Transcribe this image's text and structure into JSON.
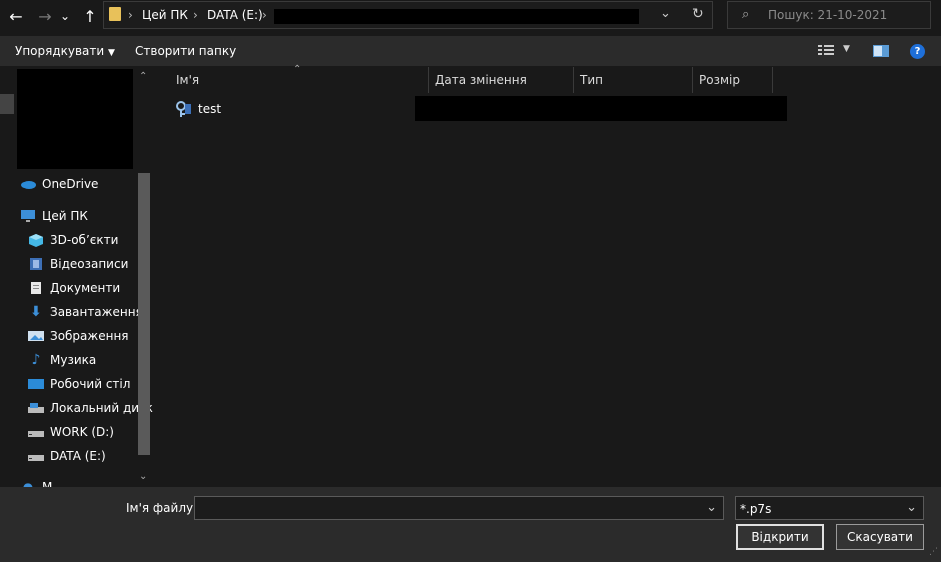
{
  "nav": {
    "back": "←",
    "forward": "→",
    "recent": "⌄",
    "up": "↑"
  },
  "address": {
    "crumbs": [
      "Цей ПК",
      "DATA (E:)"
    ],
    "sep": "›"
  },
  "search": {
    "placeholder": "Пошук: 21-10-2021"
  },
  "toolbar": {
    "organize": "Упорядкувати",
    "new_folder": "Створити папку"
  },
  "sidebar": {
    "onedrive": "OneDrive",
    "this_pc": "Цей ПК",
    "items": [
      {
        "label": "3D-об’єкти",
        "icon": "cube-icon"
      },
      {
        "label": "Відеозаписи",
        "icon": "video-icon"
      },
      {
        "label": "Документи",
        "icon": "document-icon"
      },
      {
        "label": "Завантаження",
        "icon": "download-icon"
      },
      {
        "label": "Зображення",
        "icon": "image-icon"
      },
      {
        "label": "Музика",
        "icon": "music-icon"
      },
      {
        "label": "Робочий стіл",
        "icon": "desktop-icon"
      },
      {
        "label": "Локальний диск",
        "icon": "drive-icon"
      },
      {
        "label": "WORK (D:)",
        "icon": "drive-icon"
      },
      {
        "label": "DATA (E:)",
        "icon": "drive-icon"
      }
    ],
    "partial": "М"
  },
  "columns": {
    "name": "Ім'я",
    "date": "Дата змінення",
    "type": "Тип",
    "size": "Розмір"
  },
  "files": [
    {
      "name": "test",
      "icon": "certificate-key-icon"
    }
  ],
  "bottom": {
    "filename_label": "Ім'я файлу:",
    "filename_value": "",
    "filter": "*.p7s",
    "open": "Відкрити",
    "cancel": "Скасувати"
  },
  "colors": {
    "accent": "#0078d7",
    "bg": "#191919",
    "panel": "#2b2b2b"
  }
}
